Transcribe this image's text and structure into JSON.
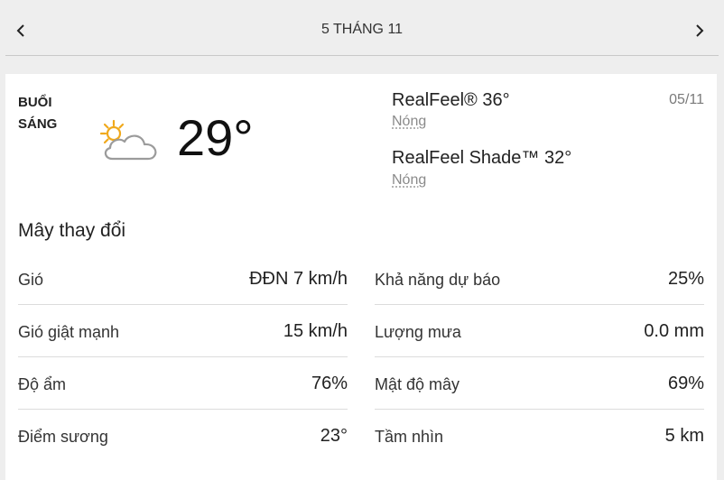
{
  "header": {
    "title": "5 THÁNG 11",
    "prev_icon": "chevron-left-icon",
    "next_icon": "chevron-right-icon"
  },
  "card": {
    "period_line1": "BUỔI",
    "period_line2": "SÁNG",
    "icon": "partly-sunny-icon",
    "temperature": "29°",
    "realfeel": "RealFeel® 36°",
    "realfeel_desc": "Nóng",
    "realfeel_shade": "RealFeel Shade™ 32°",
    "realfeel_shade_desc": "Nóng",
    "date": "05/11",
    "phrase": "Mây thay đổi"
  },
  "stats": {
    "left": [
      {
        "label": "Gió",
        "value": "ĐĐN 7 km/h"
      },
      {
        "label": "Gió giật mạnh",
        "value": "15 km/h"
      },
      {
        "label": "Độ ẩm",
        "value": "76%"
      },
      {
        "label": "Điểm sương",
        "value": "23°"
      }
    ],
    "right": [
      {
        "label": "Khả năng dự báo",
        "value": "25%"
      },
      {
        "label": "Lượng mưa",
        "value": "0.0 mm"
      },
      {
        "label": "Mật độ mây",
        "value": "69%"
      },
      {
        "label": "Tầm nhìn",
        "value": "5 km"
      }
    ]
  }
}
